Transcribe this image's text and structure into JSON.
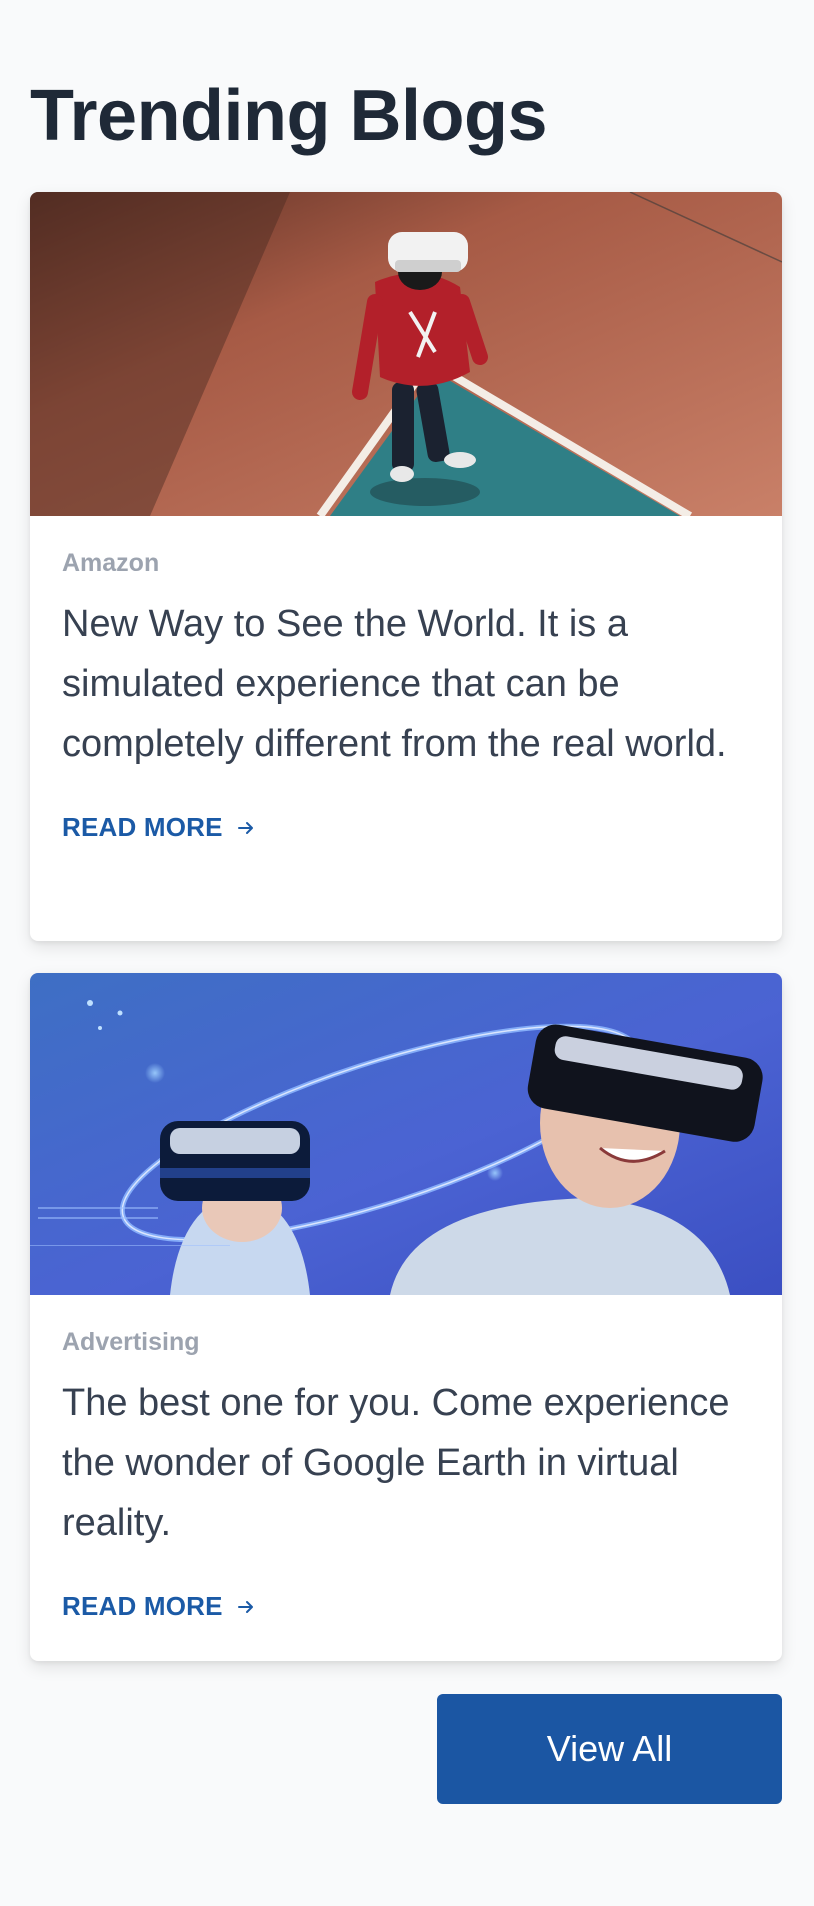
{
  "section": {
    "title": "Trending Blogs"
  },
  "posts": [
    {
      "category": "Amazon",
      "excerpt": "New Way to See the World. It is a simulated experience that can be completely different from the real world.",
      "cta_label": "READ MORE",
      "image_icon": "vr-user-on-court-photo"
    },
    {
      "category": "Advertising",
      "excerpt": "The best one for you. Come experience the wonder of Google Earth in virtual reality.",
      "cta_label": "READ MORE",
      "image_icon": "vr-headset-users-photo"
    }
  ],
  "footer": {
    "view_all_label": "View All"
  },
  "colors": {
    "accent": "#1b56a3",
    "heading": "#1f2937",
    "category": "#9ca3af"
  }
}
